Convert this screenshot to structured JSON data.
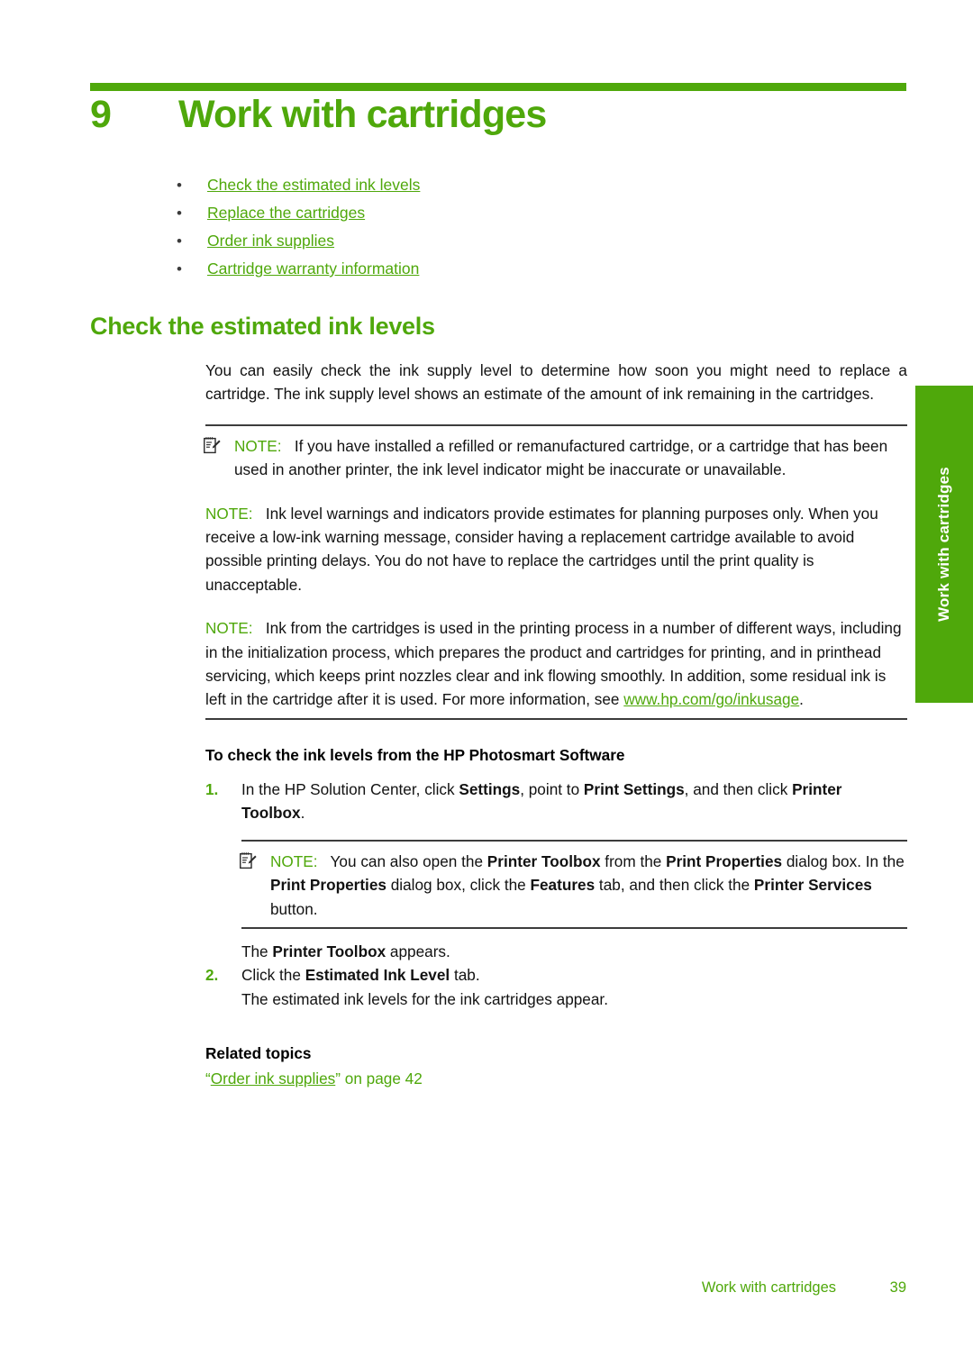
{
  "chapter": {
    "number": "9",
    "title": "Work with cartridges"
  },
  "toc": {
    "bullet": "•",
    "items": [
      {
        "label": "Check the estimated ink levels"
      },
      {
        "label": "Replace the cartridges"
      },
      {
        "label": "Order ink supplies"
      },
      {
        "label": "Cartridge warranty information"
      }
    ]
  },
  "section": {
    "heading": "Check the estimated ink levels",
    "intro": "You can easily check the ink supply level to determine how soon you might need to replace a cartridge. The ink supply level shows an estimate of the amount of ink remaining in the cartridges."
  },
  "notes": {
    "label": "NOTE:",
    "icon": "note-pencil-icon",
    "note1": "If you have installed a refilled or remanufactured cartridge, or a cartridge that has been used in another printer, the ink level indicator might be inaccurate or unavailable.",
    "note2": "Ink level warnings and indicators provide estimates for planning purposes only. When you receive a low-ink warning message, consider having a replacement cartridge available to avoid possible printing delays. You do not have to replace the cartridges until the print quality is unacceptable.",
    "note3_part1": "Ink from the cartridges is used in the printing process in a number of different ways, including in the initialization process, which prepares the product and cartridges for printing, and in printhead servicing, which keeps print nozzles clear and ink flowing smoothly. In addition, some residual ink is left in the cartridge after it is used. For more information, see ",
    "note3_link": "www.hp.com/go/inkusage",
    "note3_part2": "."
  },
  "procedure": {
    "title": "To check the ink levels from the HP Photosmart Software",
    "step1": {
      "num": "1.",
      "t1": "In the HP Solution Center, click ",
      "b1": "Settings",
      "t2": ", point to ",
      "b2": "Print Settings",
      "t3": ", and then click ",
      "b3": "Printer Toolbox",
      "t4": "."
    },
    "nested_note": {
      "t1": "You can also open the ",
      "b1": "Printer Toolbox",
      "t2": " from the ",
      "b2": "Print Properties",
      "t3": " dialog box. In the ",
      "b3": "Print Properties",
      "t4": " dialog box, click the ",
      "b4": "Features",
      "t5": " tab, and then click the ",
      "b5": "Printer Services",
      "t6": " button."
    },
    "after_note": {
      "t1": "The ",
      "b1": "Printer Toolbox",
      "t2": " appears."
    },
    "step2": {
      "num": "2.",
      "t1": "Click the ",
      "b1": "Estimated Ink Level",
      "t2": " tab.",
      "sub": "The estimated ink levels for the ink cartridges appear."
    }
  },
  "related": {
    "heading": "Related topics",
    "quote_open": "“",
    "link": "Order ink supplies",
    "quote_close": "”",
    "suffix": " on page 42"
  },
  "thumb_tab": {
    "label": "Work with cartridges"
  },
  "footer": {
    "title": "Work with cartridges",
    "page": "39"
  },
  "colors": {
    "accent_green": "#4FA80B",
    "body_text": "#121212",
    "rule": "#3c3c3c"
  }
}
